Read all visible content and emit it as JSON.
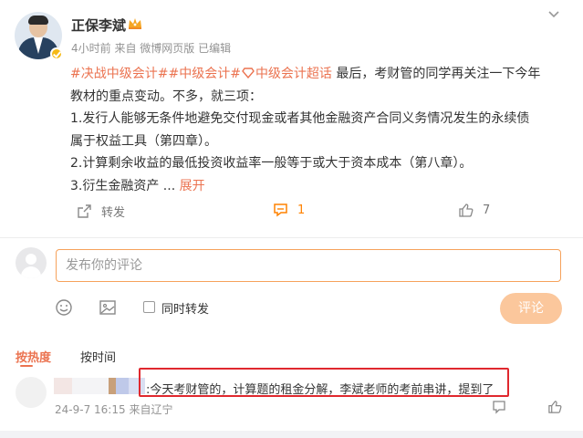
{
  "post": {
    "author": "正保李斌",
    "time": "4小时前",
    "source": "来自 微博网页版",
    "edited": "已编辑",
    "tags": [
      "#决战中级会计#",
      "#中级会计#",
      "中级会计超话"
    ],
    "line1_rest": " 最后，考财管的同学再关注一下今年",
    "line2": "教材的重点变动。不多，就三项：",
    "line3": "1.发行人能够无条件地避免交付现金或者其他金融资产合同义务情况发生的永续债",
    "line4": "属于权益工具（第四章）。",
    "line5": "2.计算剩余收益的最低投资收益率一般等于或大于资本成本（第八章）。",
    "line6": "3.衍生金融资产",
    "ellipsis": " ... ",
    "expand": "展开"
  },
  "actions": {
    "repost_label": "转发",
    "comment_count": "1",
    "like_count": "7"
  },
  "compose": {
    "placeholder": "发布你的评论",
    "repost_label": "同时转发",
    "submit_label": "评论"
  },
  "sort": {
    "hot": "按热度",
    "time": "按时间"
  },
  "comment": {
    "text": ":今天考财管的，计算题的租金分解，李斌老师的考前串讲，提到了",
    "time": "24-9-7 16:15",
    "location": "来自辽宁"
  },
  "colors": {
    "accent": "#eb7350",
    "input_border": "#f6a25b",
    "submit_bg": "#fbc79c",
    "highlight": "#e0282e",
    "verified": "#f5b916"
  },
  "icons": [
    "more-icon",
    "crown-icon",
    "repost-icon",
    "comment-icon",
    "like-icon",
    "emoji-icon",
    "image-icon",
    "reply-icon"
  ]
}
